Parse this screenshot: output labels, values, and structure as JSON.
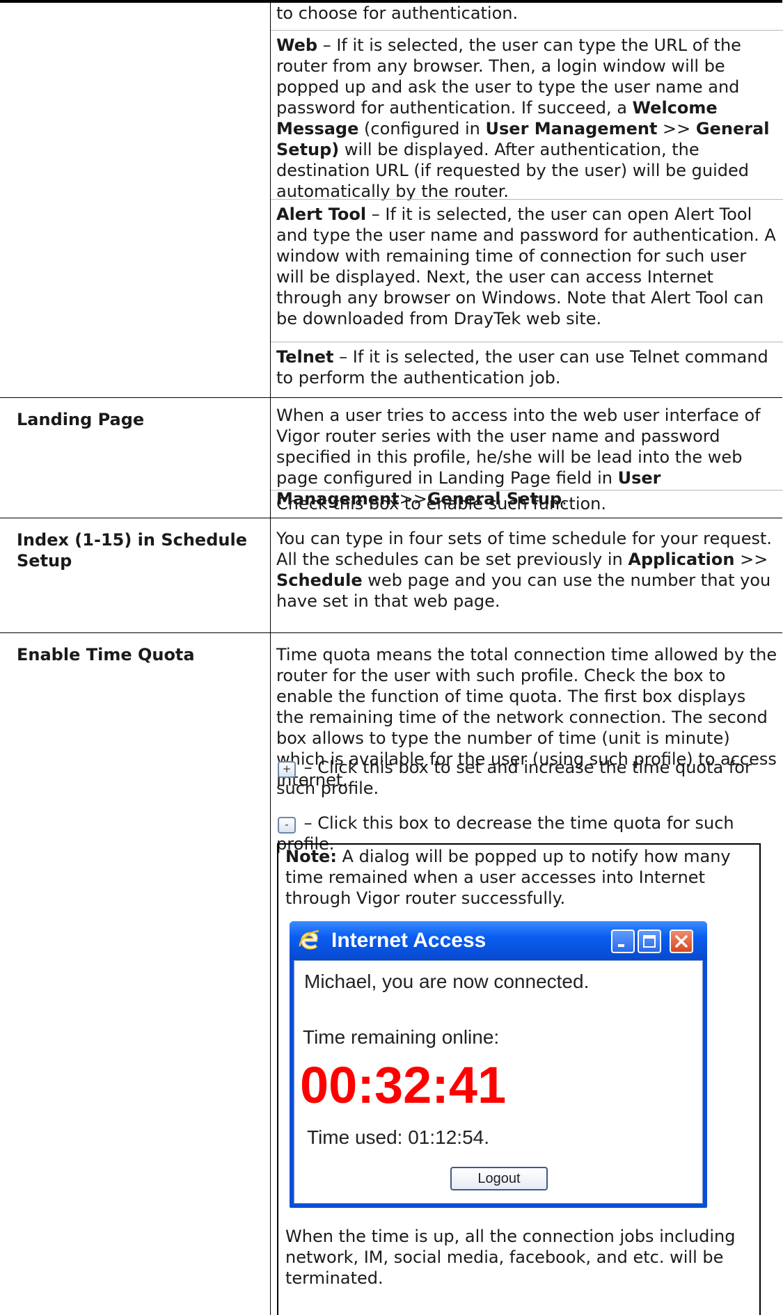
{
  "auth_cell": {
    "intro": "to choose for authentication.",
    "web": {
      "label": "Web",
      "t1": " – If it is selected, the user can type the URL of the router from any browser. Then, a login window will be popped up and ask the user to type the user name and password for authentication. If succeed, a ",
      "b1": "Welcome Message",
      "t2": " (configured in ",
      "b2": "User Management",
      "t3": " >> ",
      "b3": "General Setup)",
      "t4": " will be displayed. After authentication, the destination URL (if requested by the user) will be guided automatically by the router."
    },
    "alert": {
      "label": "Alert Tool",
      "text": " – If it is selected, the user can open Alert Tool and type the user name and password for authentication. A window with remaining time of connection for such user will be displayed. Next, the user can access Internet through any browser on Windows. Note that Alert Tool can be downloaded from DrayTek web site."
    },
    "telnet": {
      "label": "Telnet",
      "text": " – If it is selected, the user can use Telnet command to perform the authentication job."
    }
  },
  "landing": {
    "label": "Landing Page",
    "t1": "When a user tries to access into the web user interface of Vigor router series with the user name and password specified in this profile, he/she will be lead into the web page configured in Landing Page field in ",
    "b1": "User Management",
    "t2": ">>",
    "b2": "General Setup",
    "t3": ".",
    "check": "Check this box to enable such function."
  },
  "schedule": {
    "label": "Index (1-15) in Schedule Setup",
    "t1": "You can type in four sets of time schedule for your request. All the schedules can be set previously in ",
    "b1": "Application",
    "t2": " >> ",
    "b2": "Schedule",
    "t3": " web page and you can use the number that you have set in that web page."
  },
  "quota": {
    "label": "Enable Time Quota",
    "desc": "Time quota means the total connection time allowed by the router for the user with such profile. Check the box to enable the function of time quota. The first box displays the remaining time of the network connection. The second box allows to type the number of time (unit is minute) which is available for the user (using such profile) to access Internet.",
    "plus_symbol": "+",
    "plus_text": " – Click this box to set and increase the time quota for such profile.",
    "minus_symbol": "-",
    "minus_text": " – Click this box to decrease the time quota for such profile.",
    "note_label": "Note:",
    "note_text": " A dialog will be popped up to notify how many time remained when a user accesses into Internet through Vigor router successfully.",
    "outro": "When the time is up, all the connection jobs including network, IM, social media, facebook, and etc. will be terminated."
  },
  "dialog": {
    "title": "Internet Access",
    "message": "Michael, you are now connected.",
    "remaining_label": "Time remaining online:",
    "countdown": "00:32:41",
    "used_label": "Time used: 01:12:54.",
    "logout_label": "Logout",
    "icons": [
      "internet-explorer-icon",
      "minimize-icon",
      "maximize-icon",
      "close-icon"
    ],
    "colors": {
      "titlebar": "#0a5ef0",
      "countdown": "#ff0000",
      "close": "#d9461f"
    }
  }
}
